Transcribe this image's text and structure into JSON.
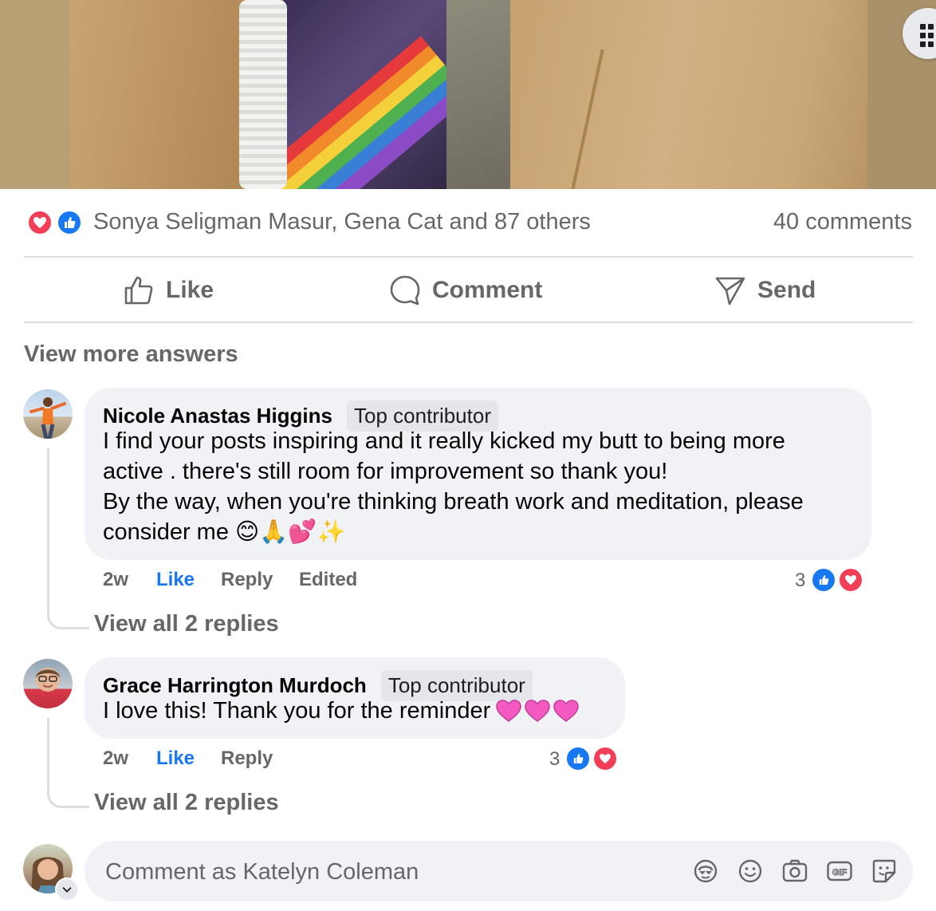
{
  "post": {
    "reactions_summary": "Sonya Seligman Masur, Gena Cat and 87 others",
    "comments_count": "40 comments"
  },
  "actions": {
    "like": "Like",
    "comment": "Comment",
    "send": "Send"
  },
  "view_more": "View more answers",
  "comments": [
    {
      "author": "Nicole Anastas Higgins",
      "badge": "Top contributor",
      "lines": [
        "I find your posts inspiring and it really kicked my butt to being more",
        "active . there's still room for improvement so thank you!",
        "By the way, when you're thinking breath work and meditation, please",
        "consider me 😊🙏💕✨"
      ],
      "time": "2w",
      "like": "Like",
      "reply": "Reply",
      "edited": "Edited",
      "reaction_count": "3",
      "view_replies": "View all 2 replies"
    },
    {
      "author": "Grace Harrington Murdoch",
      "badge": "Top contributor",
      "text": "I love this! Thank you for the reminder",
      "time": "2w",
      "like": "Like",
      "reply": "Reply",
      "reaction_count": "3",
      "view_replies": "View all 2 replies"
    }
  ],
  "composer": {
    "placeholder": "Comment as Katelyn Coleman",
    "icons": [
      "avatar-sticker-icon",
      "emoji-icon",
      "camera-icon",
      "gif-icon",
      "sticker-icon"
    ]
  },
  "colors": {
    "like_blue": "#1877f2",
    "love_red": "#f33e58",
    "muted": "#65676b",
    "bubble": "#f0f2f5"
  }
}
